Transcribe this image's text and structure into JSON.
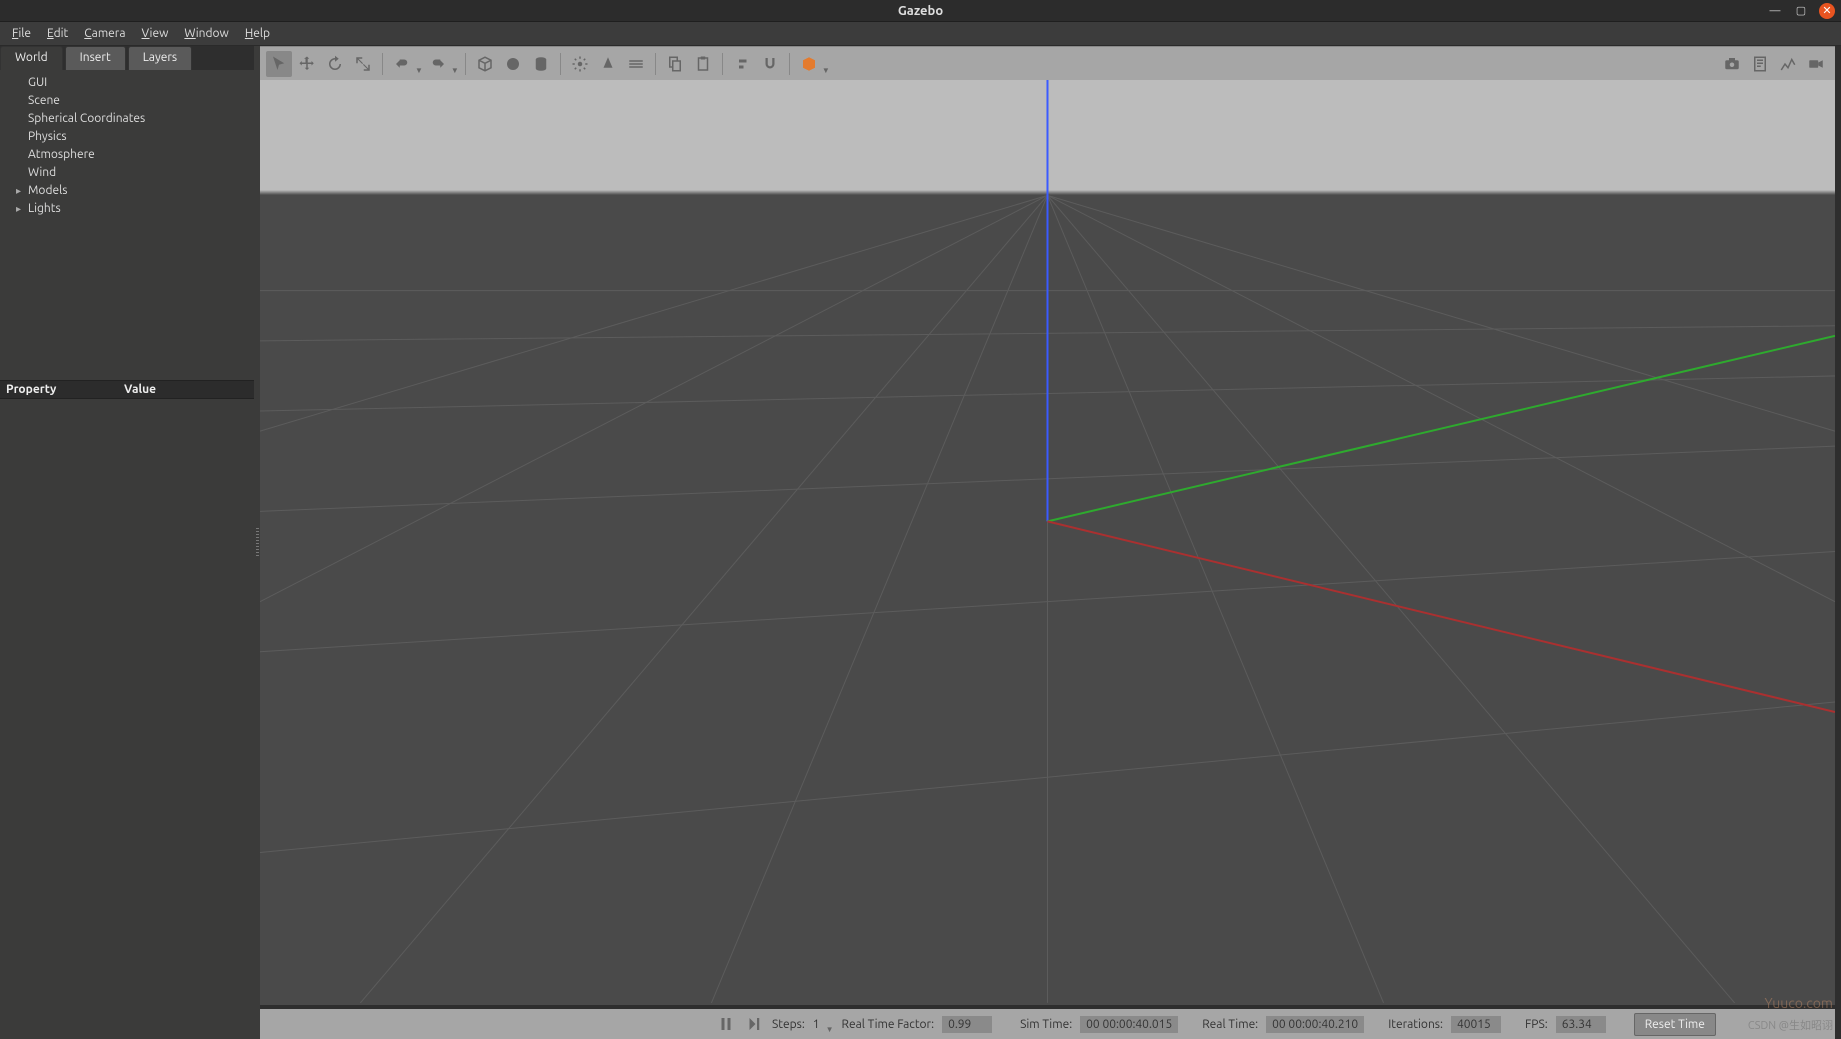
{
  "window": {
    "title": "Gazebo",
    "min_tip": "Minimize",
    "max_tip": "Maximize",
    "close_tip": "Close"
  },
  "menu": {
    "file": "File",
    "edit": "Edit",
    "camera": "Camera",
    "view": "View",
    "window": "Window",
    "help": "Help"
  },
  "sidebar": {
    "tabs": {
      "world": "World",
      "insert": "Insert",
      "layers": "Layers"
    },
    "tree": {
      "gui": "GUI",
      "scene": "Scene",
      "spherical": "Spherical Coordinates",
      "physics": "Physics",
      "atmosphere": "Atmosphere",
      "wind": "Wind",
      "models": "Models",
      "lights": "Lights"
    },
    "prop": {
      "property": "Property",
      "value": "Value"
    }
  },
  "toolbar": {
    "select": "select",
    "translate": "translate",
    "rotate": "rotate",
    "scale": "scale",
    "undo": "undo",
    "redo": "redo",
    "box": "box",
    "sphere": "sphere",
    "cylinder": "cylinder",
    "pointlight": "point-light",
    "spotlight": "spot-light",
    "dirlight": "directional-light",
    "copy": "copy",
    "paste": "paste",
    "align": "align",
    "snap": "snap",
    "transparent": "view-angle",
    "camera": "screenshot",
    "log": "log",
    "plot": "plot",
    "record": "record"
  },
  "status": {
    "steps_label": "Steps:",
    "steps_value": "1",
    "rtf_label": "Real Time Factor:",
    "rtf_value": "0.99",
    "sim_label": "Sim Time:",
    "sim_value": "00 00:00:40.015",
    "real_label": "Real Time:",
    "real_value": "00 00:00:40.210",
    "iter_label": "Iterations:",
    "iter_value": "40015",
    "fps_label": "FPS:",
    "fps_value": "63.34",
    "reset": "Reset Time"
  },
  "watermark": "Yuuco.com",
  "attribution": "CSDN @生如昭诩"
}
